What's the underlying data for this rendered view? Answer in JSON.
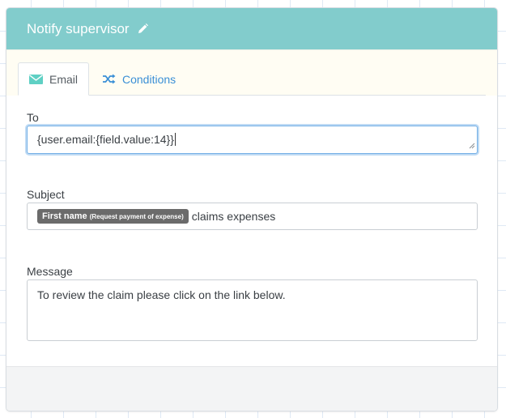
{
  "header": {
    "title": "Notify supervisor",
    "edit_icon": "pencil-icon"
  },
  "tabs": [
    {
      "label": "Email",
      "icon": "envelope-icon",
      "active": true
    },
    {
      "label": "Conditions",
      "icon": "shuffle-icon",
      "active": false
    }
  ],
  "colors": {
    "header_bg": "#82cccc",
    "tab_link": "#3a8fd6",
    "token_bg": "#6b6b6b",
    "focus_border": "#74b0e6"
  },
  "to": {
    "label": "To",
    "value": "{user.email:{field.value:14}}"
  },
  "subject": {
    "label": "Subject",
    "token_name": "First name",
    "token_context": "(Request payment of expense)",
    "text": "claims expenses"
  },
  "message": {
    "label": "Message",
    "value": "To review the claim please click on the link below."
  }
}
